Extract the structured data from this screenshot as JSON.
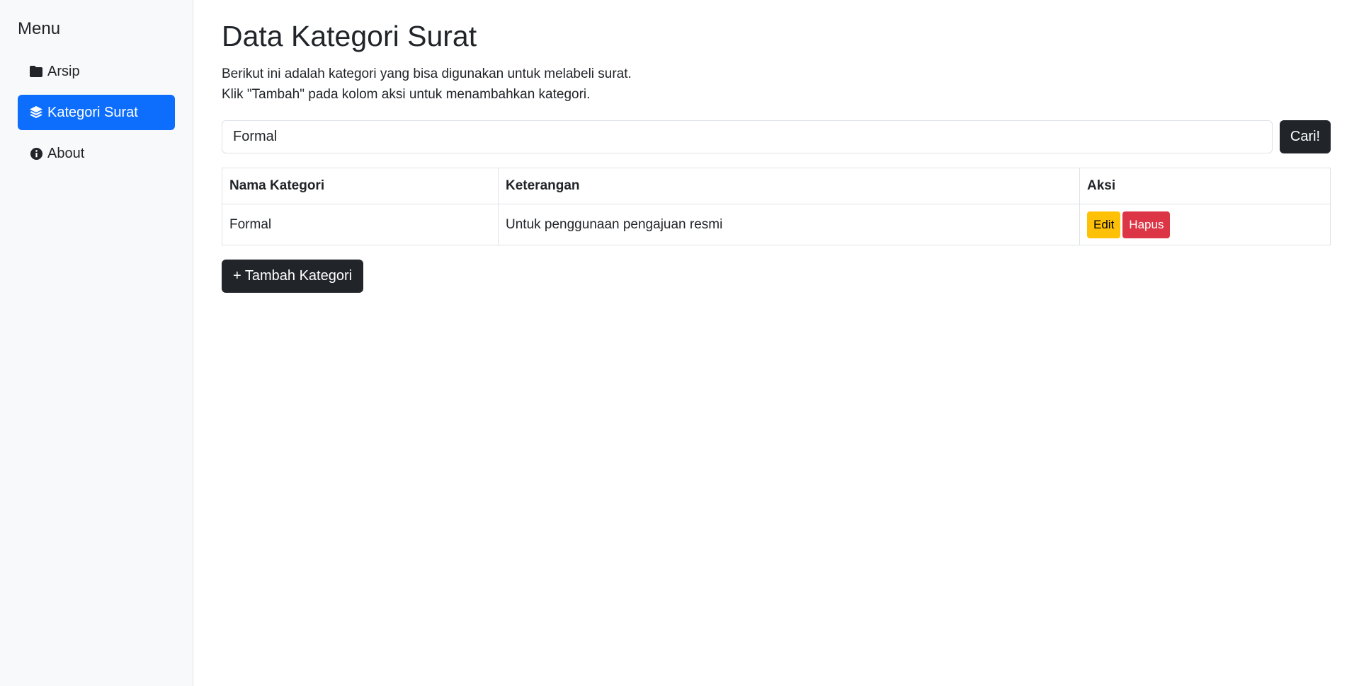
{
  "sidebar": {
    "title": "Menu",
    "items": [
      {
        "label": "Arsip",
        "icon": "folder-icon",
        "active": false
      },
      {
        "label": "Kategori Surat",
        "icon": "layers-icon",
        "active": true
      },
      {
        "label": "About",
        "icon": "info-circle-icon",
        "active": false
      }
    ]
  },
  "main": {
    "title": "Data Kategori Surat",
    "description_line1": "Berikut ini adalah kategori yang bisa digunakan untuk melabeli surat.",
    "description_line2": "Klik \"Tambah\" pada kolom aksi untuk menambahkan kategori.",
    "search": {
      "value": "Formal",
      "button_label": "Cari!"
    },
    "table": {
      "headers": [
        "Nama Kategori",
        "Keterangan",
        "Aksi"
      ],
      "rows": [
        {
          "nama": "Formal",
          "keterangan": "Untuk penggunaan pengajuan resmi",
          "edit_label": "Edit",
          "delete_label": "Hapus"
        }
      ]
    },
    "add_button_label": "+ Tambah Kategori"
  },
  "colors": {
    "active": "#0d6efd",
    "dark": "#212529",
    "warning": "#ffc107",
    "danger": "#dc3545",
    "sidebar_bg": "#f8f9fa"
  }
}
